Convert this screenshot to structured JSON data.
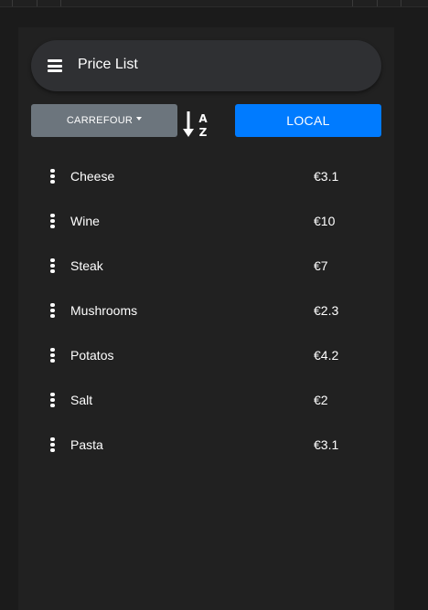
{
  "header": {
    "title": "Price List"
  },
  "toolbar": {
    "store_label": "CARREFOUR",
    "local_label": "LOCAL"
  },
  "sort_icon": {
    "top": "A",
    "bottom": "Z"
  },
  "items": [
    {
      "name": "Cheese",
      "price": "€3.1"
    },
    {
      "name": "Wine",
      "price": "€10"
    },
    {
      "name": "Steak",
      "price": "€7"
    },
    {
      "name": "Mushrooms",
      "price": "€2.3"
    },
    {
      "name": "Potatos",
      "price": "€4.2"
    },
    {
      "name": "Salt",
      "price": "€2"
    },
    {
      "name": "Pasta",
      "price": "€3.1"
    }
  ],
  "colors": {
    "background": "#1b1b1b",
    "panel": "#212121",
    "header": "#2f3033",
    "store_button": "#6c757d",
    "local_button": "#007bff"
  }
}
